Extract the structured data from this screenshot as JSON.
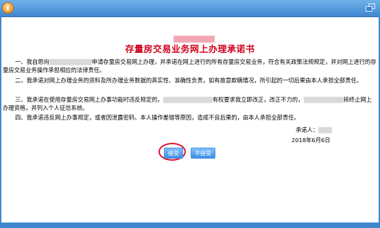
{
  "titlebar": {
    "icon": "info-icon",
    "icon_glyph": "i",
    "right_icon": "restore-window-icon"
  },
  "document": {
    "title": "存量房交易业务网上办理承诺书",
    "para1_a": "一、我自愿向",
    "para1_b": "申请存量房交易网上办理，并承诺在网上进行的所有存量房交易业务，符合有关政策法规规定，并对网上进行的存量房交易业务操作承担相应的法律责任。",
    "para2": "二、我承诺对网上办理业务的资料及所办理业务数据的真实性、准确性负责，如有故意欺瞒情况，所引起的一切后果由本人承担全部责任。",
    "para3_a": "三、我承诺在使用存量房交易网上办事功能时违反规定的，",
    "para3_b": "有权要求我立即改正，改正不力的，",
    "para3_c": "将终止网上办理资格，并列入个人征信系统。",
    "para4": "四、我承诺违反网上办事规定，或者因泄露密码、本人操作差错等原因，造成不良后果的，由本人承担全部责任。",
    "signer_label": "承诺人：",
    "date": "2018年6月6日"
  },
  "buttons": {
    "accept": "接受",
    "reject": "不接受"
  },
  "colors": {
    "title": "#d0021b",
    "accent": "#3f86cf",
    "highlight_circle": "#e0102a"
  }
}
